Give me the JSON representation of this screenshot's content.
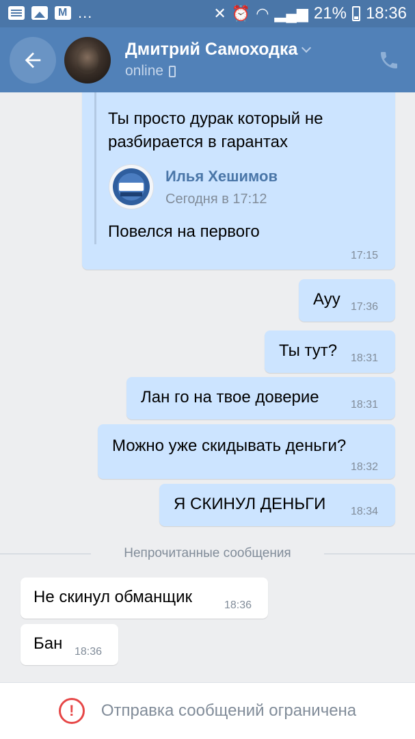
{
  "statusbar": {
    "dots": "...",
    "battery": "21%",
    "time": "18:36"
  },
  "header": {
    "name": "Дмитрий Самоходка",
    "status": "online"
  },
  "forwarded": {
    "line1": "Ты просто дурак который не",
    "line2": "разбирается в гарантах",
    "author": "Илья Хешимов",
    "date": "Сегодня в 17:12",
    "text": "Повелся на первого",
    "time": "17:15"
  },
  "messages": [
    {
      "text": "Ауу",
      "time": "17:36",
      "direction": "out"
    },
    {
      "text": "Ты тут?",
      "time": "18:31",
      "direction": "out"
    },
    {
      "text": "Лан го на твое доверие",
      "time": "18:31",
      "direction": "out"
    },
    {
      "text": "Можно уже скидывать деньги?",
      "time": "18:32",
      "direction": "out"
    },
    {
      "text": "Я СКИНУЛ ДЕНЬГИ",
      "time": "18:34",
      "direction": "out"
    },
    {
      "text": "Не скинул обманщик",
      "time": "18:36",
      "direction": "in"
    },
    {
      "text": "Бан",
      "time": "18:36",
      "direction": "in"
    }
  ],
  "divider": {
    "label": "Непрочитанные сообщения"
  },
  "bottom": {
    "restriction": "Отправка сообщений ограничена"
  },
  "colors": {
    "header": "#5181b8",
    "statusbar": "#4a76a8",
    "outgoing_bubble": "#cce4ff",
    "incoming_bubble": "#ffffff",
    "background": "#edeef0",
    "warning": "#e64646"
  },
  "icons": [
    "message-icon",
    "image-icon",
    "mail-icon",
    "mute-icon",
    "alarm-icon",
    "wifi-icon",
    "signal-icon",
    "battery-icon",
    "back-arrow-icon",
    "chevron-down-icon",
    "phone-icon",
    "call-icon",
    "warning-icon"
  ]
}
